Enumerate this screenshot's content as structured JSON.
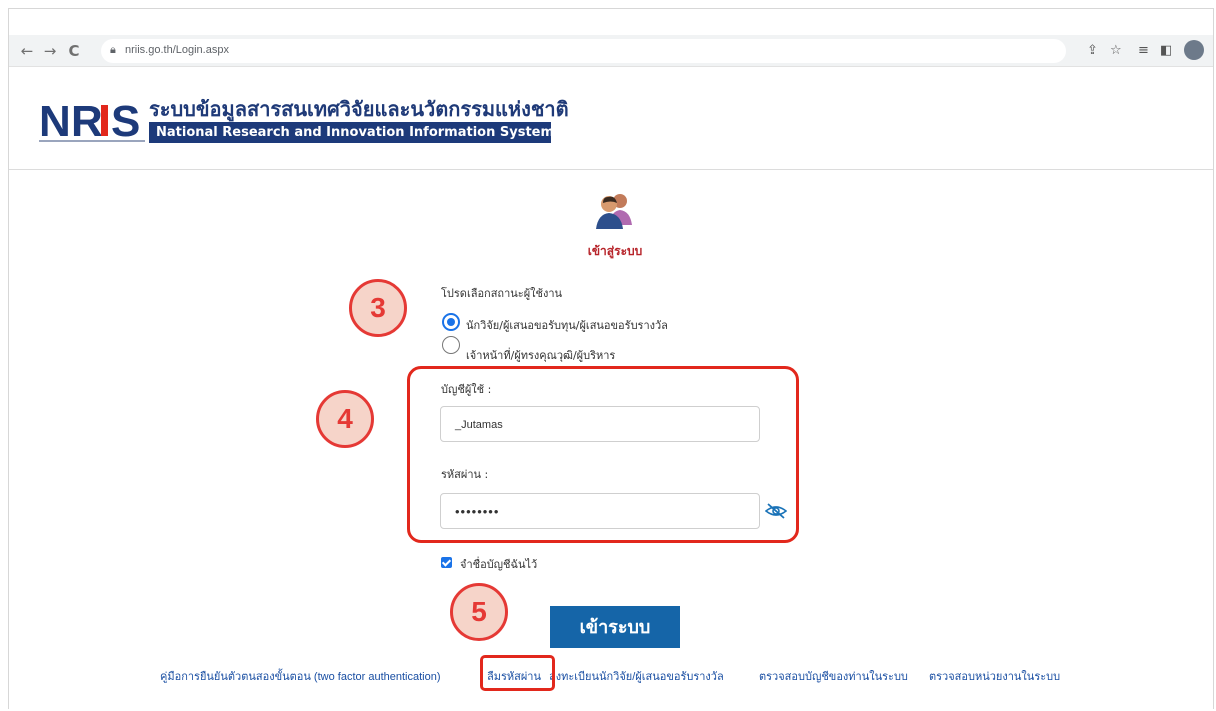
{
  "browser": {
    "url": "nriis.go.th/Login.aspx"
  },
  "header": {
    "thai_title": "ระบบข้อมูลสารสนเทศวิจัยและนวัตกรรมแห่งชาติ",
    "english_title": "National Research and Innovation Information System",
    "logo_text": "NRIIS"
  },
  "login": {
    "heading": "เข้าสู่ระบบ",
    "status_label": "โปรดเลือกสถานะผู้ใช้งาน",
    "options": [
      {
        "label": "นักวิจัย/ผู้เสนอขอรับทุน/ผู้เสนอขอรับรางวัล",
        "selected": true
      },
      {
        "label": "เจ้าหน้าที่/ผู้ทรงคุณวุฒิ/ผู้บริหาร",
        "selected": false
      }
    ],
    "username_label": "บัญชีผู้ใช้ :",
    "username_value": "_Jutamas",
    "password_label": "รหัสผ่าน :",
    "password_value": "••••••••",
    "remember_label": "จำชื่อบัญชีฉันไว้",
    "remember_checked": true,
    "submit_label": "เข้าระบบ"
  },
  "footer_links": [
    "คู่มือการยืนยันตัวตนสองขั้นตอน (two factor authentication)",
    "ลืมรหัสผ่าน",
    "ลงทะเบียนนักวิจัย/ผู้เสนอขอรับรางวัล",
    "ตรวจสอบบัญชีของท่านในระบบ",
    "ตรวจสอบหน่วยงานในระบบ"
  ],
  "annotations": {
    "step3": "3",
    "step4": "4",
    "step5": "5"
  },
  "colors": {
    "brand_navy": "#1d3a7a",
    "submit_blue": "#1565a8",
    "annotation_red": "#e2281c",
    "heading_red": "#b7242a"
  }
}
